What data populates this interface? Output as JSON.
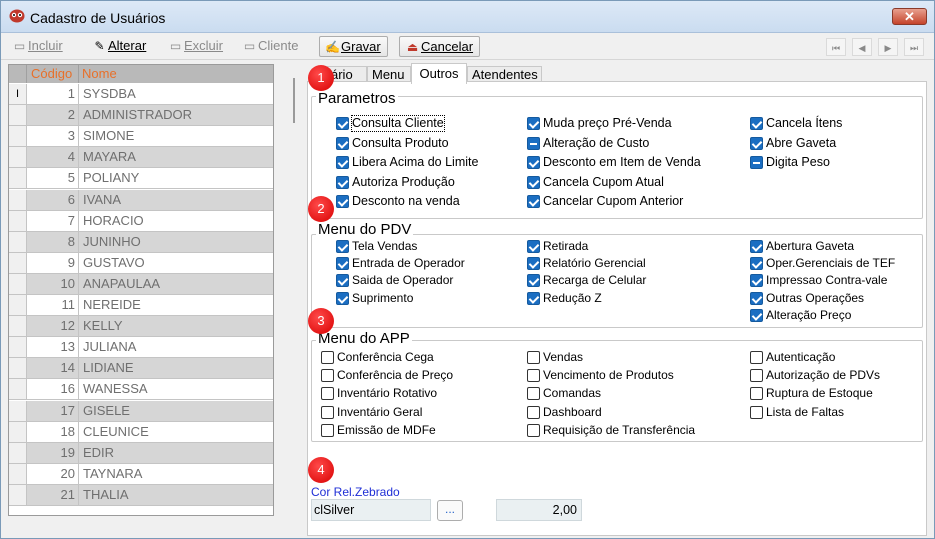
{
  "window": {
    "title": "Cadastro de Usuários",
    "close_glyph": "✕"
  },
  "toolbar": {
    "incluir": "Incluir",
    "alterar": "Alterar",
    "excluir": "Excluir",
    "cliente": "Cliente",
    "gravar": "Gravar",
    "cancelar": "Cancelar",
    "nav": [
      "⏮",
      "◀",
      "▶",
      "⏭"
    ]
  },
  "grid": {
    "headers": {
      "code": "Código",
      "name": "Nome"
    },
    "cursor_glyph": "I",
    "rows": [
      {
        "code": "1",
        "name": "SYSDBA"
      },
      {
        "code": "2",
        "name": "ADMINISTRADOR"
      },
      {
        "code": "3",
        "name": "SIMONE"
      },
      {
        "code": "4",
        "name": "MAYARA"
      },
      {
        "code": "5",
        "name": "POLIANY"
      },
      {
        "code": "6",
        "name": "IVANA"
      },
      {
        "code": "7",
        "name": "HORACIO"
      },
      {
        "code": "8",
        "name": "JUNINHO"
      },
      {
        "code": "9",
        "name": "GUSTAVO"
      },
      {
        "code": "10",
        "name": "ANAPAULAA"
      },
      {
        "code": "11",
        "name": "NEREIDE"
      },
      {
        "code": "12",
        "name": "KELLY"
      },
      {
        "code": "13",
        "name": "JULIANA"
      },
      {
        "code": "14",
        "name": "LIDIANE"
      },
      {
        "code": "16",
        "name": "WANESSA"
      },
      {
        "code": "17",
        "name": "GISELE"
      },
      {
        "code": "18",
        "name": "CLEUNICE"
      },
      {
        "code": "19",
        "name": "EDIR"
      },
      {
        "code": "20",
        "name": "TAYNARA"
      },
      {
        "code": "21",
        "name": "THALIA"
      }
    ]
  },
  "tabs": [
    "ário",
    "Menu",
    "Outros",
    "Atendentes"
  ],
  "markers": [
    "1",
    "2",
    "3",
    "4"
  ],
  "parametros": {
    "title": "Parametros",
    "col1": [
      {
        "label": "Consulta Cliente",
        "state": "on"
      },
      {
        "label": "Consulta Produto",
        "state": "on"
      },
      {
        "label": "Libera Acima do Limite",
        "state": "on"
      },
      {
        "label": "Autoriza Produção",
        "state": "on"
      },
      {
        "label": "Desconto na venda",
        "state": "on"
      }
    ],
    "col2": [
      {
        "label": "Muda preço Pré-Venda",
        "state": "on"
      },
      {
        "label": "Alteração de Custo",
        "state": "mix"
      },
      {
        "label": "Desconto em Item de Venda",
        "state": "on"
      },
      {
        "label": "Cancela Cupom Atual",
        "state": "on"
      },
      {
        "label": "Cancelar Cupom Anterior",
        "state": "on"
      }
    ],
    "col3": [
      {
        "label": "Cancela Ítens",
        "state": "on"
      },
      {
        "label": "Abre Gaveta",
        "state": "on"
      },
      {
        "label": "Digita Peso",
        "state": "mix"
      }
    ]
  },
  "menu_pdv": {
    "title": "Menu do PDV",
    "col1": [
      {
        "label": "Tela Vendas",
        "state": "on"
      },
      {
        "label": "Entrada de Operador",
        "state": "on"
      },
      {
        "label": "Saida de Operador",
        "state": "on"
      },
      {
        "label": "Suprimento",
        "state": "on"
      }
    ],
    "col2": [
      {
        "label": "Retirada",
        "state": "on"
      },
      {
        "label": "Relatório Gerencial",
        "state": "on"
      },
      {
        "label": "Recarga de Celular",
        "state": "on"
      },
      {
        "label": "Redução Z",
        "state": "on"
      }
    ],
    "col3": [
      {
        "label": "Abertura Gaveta",
        "state": "on"
      },
      {
        "label": "Oper.Gerenciais de TEF",
        "state": "on"
      },
      {
        "label": "Impressao Contra-vale",
        "state": "on"
      },
      {
        "label": "Outras Operações",
        "state": "on"
      },
      {
        "label": "Alteração Preço",
        "state": "on"
      }
    ]
  },
  "menu_app": {
    "title": "Menu do APP",
    "col1": [
      {
        "label": "Conferência Cega",
        "state": "off"
      },
      {
        "label": "Conferência de Preço",
        "state": "off"
      },
      {
        "label": "Inventário Rotativo",
        "state": "off"
      },
      {
        "label": "Inventário Geral",
        "state": "off"
      },
      {
        "label": "Emissão de MDFe",
        "state": "off"
      }
    ],
    "col2": [
      {
        "label": "Vendas",
        "state": "off"
      },
      {
        "label": "Vencimento de Produtos",
        "state": "off"
      },
      {
        "label": "Comandas",
        "state": "off"
      },
      {
        "label": "Dashboard",
        "state": "off"
      },
      {
        "label": "Requisição de Transferência",
        "state": "off"
      }
    ],
    "col3": [
      {
        "label": "Autenticação",
        "state": "off"
      },
      {
        "label": "Autorização de PDVs",
        "state": "off"
      },
      {
        "label": "Ruptura de Estoque",
        "state": "off"
      },
      {
        "label": "Lista de Faltas",
        "state": "off"
      }
    ]
  },
  "cor_zebrado": {
    "label": "Cor Rel.Zebrado",
    "value": "clSilver",
    "button": "...",
    "number": "2,00"
  }
}
